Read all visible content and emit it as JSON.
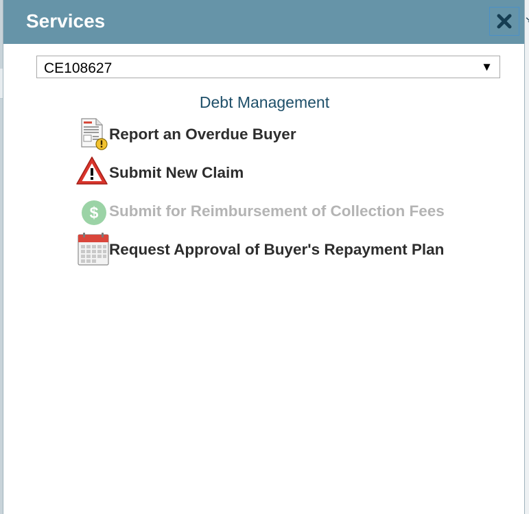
{
  "dialog": {
    "title": "Services",
    "close_label": "close"
  },
  "account_select": {
    "value": "CE108627"
  },
  "section": {
    "title": "Debt Management"
  },
  "menu": {
    "items": [
      {
        "label": "Report an Overdue Buyer",
        "icon": "document-warning-icon",
        "enabled": true
      },
      {
        "label": "Submit New Claim",
        "icon": "warning-triangle-icon",
        "enabled": true
      },
      {
        "label": "Submit for Reimbursement of Collection Fees",
        "icon": "dollar-circle-icon",
        "enabled": false
      },
      {
        "label": "Request Approval of Buyer's Repayment Plan",
        "icon": "calendar-icon",
        "enabled": true
      }
    ]
  },
  "colors": {
    "titlebar": "#6694a8",
    "section_title": "#1e4f69",
    "item_text": "#2d2d2d",
    "disabled_text": "#b4b4b4",
    "warning_red": "#d9342b",
    "dollar_green": "#9bd3a6"
  }
}
